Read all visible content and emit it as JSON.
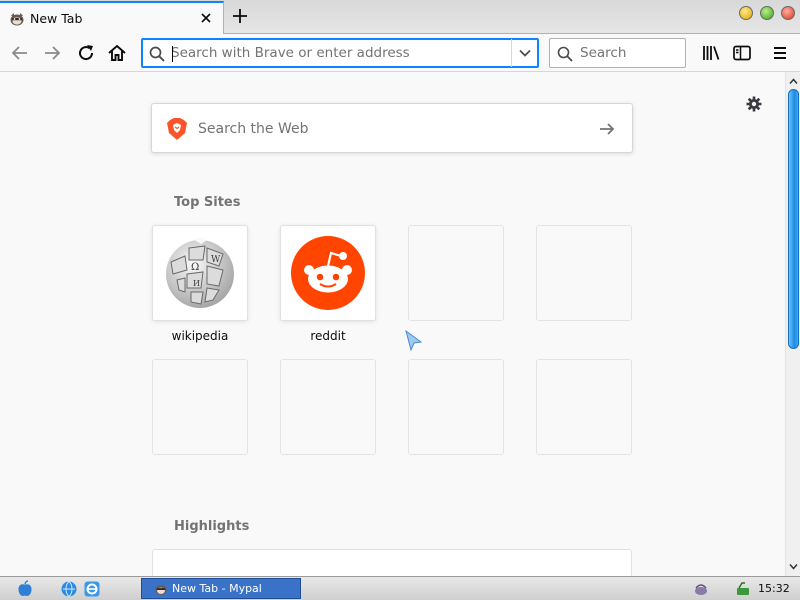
{
  "window": {
    "tab_title": "New Tab",
    "favicon": "mypal-raccoon-icon"
  },
  "toolbar": {
    "back": "back-arrow-icon",
    "forward": "forward-arrow-icon",
    "reload": "reload-icon",
    "home": "home-icon",
    "library": "library-icon",
    "sidebar": "sidebar-icon",
    "menu": "hamburger-menu-icon"
  },
  "urlbar": {
    "placeholder": "Search with Brave or enter address",
    "value": ""
  },
  "searchbar": {
    "placeholder": "Search"
  },
  "newtab": {
    "websearch_placeholder": "Search the Web",
    "top_sites_title": "Top Sites",
    "highlights_title": "Highlights",
    "top_sites": [
      {
        "label": "wikipedia",
        "icon": "wikipedia-globe-icon"
      },
      {
        "label": "reddit",
        "icon": "reddit-alien-icon"
      }
    ]
  },
  "taskbar": {
    "task_label": "New Tab - Mypal",
    "clock": "15:32"
  },
  "colors": {
    "accent": "#0a84ff",
    "taskbar_task": "#3a72c8",
    "reddit": "#ff4500",
    "scroll_thumb": "#1d8ce0"
  }
}
